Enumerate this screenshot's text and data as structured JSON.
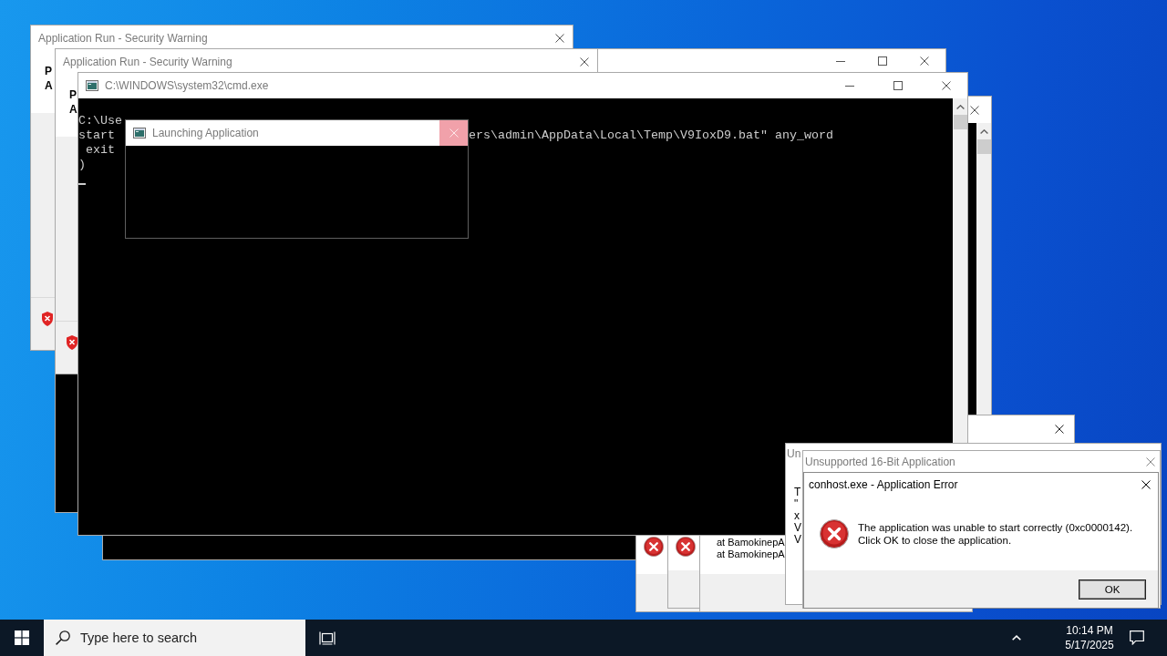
{
  "desktop": {
    "windows": [
      {
        "kind": "security_warning",
        "title": "Application Run - Security Warning",
        "active": false,
        "header_lines": [
          "P",
          "A"
        ]
      },
      {
        "kind": "console_frame_top"
      },
      {
        "kind": "security_warning",
        "title": "Application Run - Security Warning",
        "active": false,
        "header_lines": [
          "P",
          "A"
        ]
      },
      {
        "kind": "console_frame_side"
      },
      {
        "kind": "blank_dialog"
      },
      {
        "kind": "error_dialog_edge"
      },
      {
        "kind": "error_dialog_edge"
      },
      {
        "kind": "message_dialog_edge",
        "lines": [
          "at BamokinepA",
          "at BamokinepA"
        ]
      },
      {
        "kind": "console",
        "title": "C:\\WINDOWS\\system32\\cmd.exe",
        "active": false,
        "lines": [
          {
            "segments": [
              "C:\\Use"
            ]
          },
          {
            "segments": [
              "start",
              "ers\\admin\\AppData\\Local\\Temp\\V9IoxD9.bat\" any_word"
            ]
          },
          {
            "segments": [
              " exit"
            ]
          },
          {
            "segments": [
              ")"
            ]
          }
        ]
      },
      {
        "kind": "launch_dialog",
        "title": "Launching Application",
        "active": false
      },
      {
        "kind": "message_dialog",
        "title": "Un",
        "active": false,
        "lines": [
          "T",
          "\"",
          "x",
          "V",
          "V"
        ]
      },
      {
        "kind": "titled_dialog",
        "title": "Unsupported 16-Bit Application",
        "active": false
      },
      {
        "kind": "error_dialog",
        "title": "conhost.exe - Application Error",
        "active": true,
        "message": "The application was unable to start correctly (0xc0000142).\nClick OK to close the application.",
        "button": "OK"
      }
    ]
  },
  "taskbar": {
    "search": {
      "placeholder": "Type here to search"
    },
    "clock": {
      "time": "10:14 PM",
      "date": "5/17/2025"
    }
  }
}
